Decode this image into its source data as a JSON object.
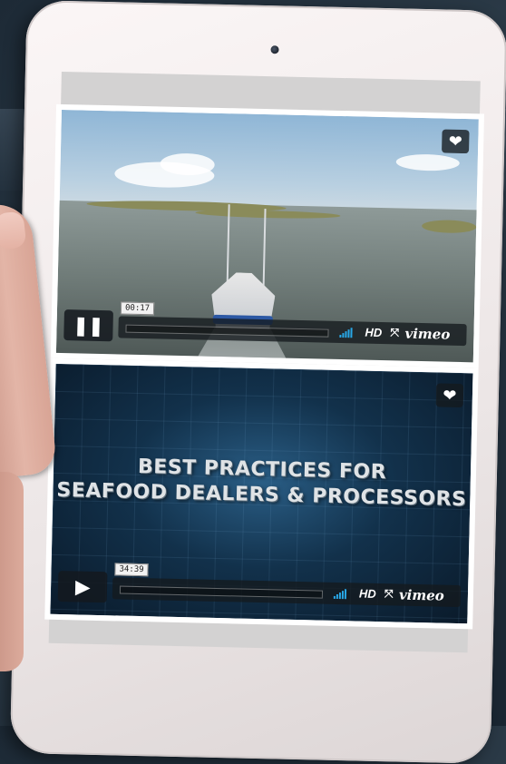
{
  "players": [
    {
      "time": "00:17",
      "state": "playing",
      "control_icon": "pause-icon",
      "quality": "HD",
      "brand": "vimeo"
    },
    {
      "time": "34:39",
      "state": "paused",
      "control_icon": "play-icon",
      "quality": "HD",
      "brand": "vimeo",
      "title_line1": "BEST PRACTICES FOR",
      "title_line2": "SEAFOOD DEALERS & PROCESSORS"
    }
  ],
  "colors": {
    "accent": "#28a7e6",
    "control_bg": "#14191e"
  }
}
